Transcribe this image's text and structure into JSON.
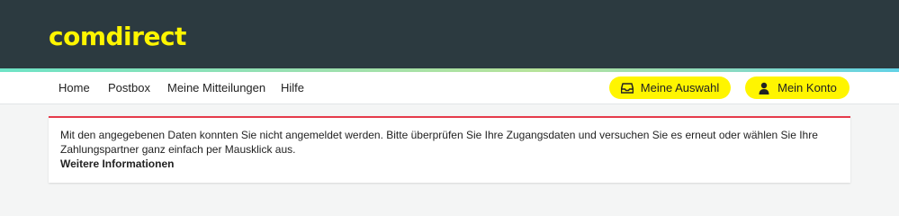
{
  "header": {
    "logo_text": "comdirect",
    "background_color": "#2c3a40",
    "logo_color": "#fff500"
  },
  "nav": {
    "items": [
      {
        "label": "Home"
      },
      {
        "label": "Postbox"
      },
      {
        "label": "Meine Mitteilungen"
      },
      {
        "label": "Hilfe"
      }
    ],
    "buttons": {
      "selection": {
        "label": "Meine Auswahl",
        "icon": "inbox-tray-icon"
      },
      "account": {
        "label": "Mein Konto",
        "icon": "user-icon"
      }
    },
    "button_color": "#fff500"
  },
  "alert": {
    "message": "Mit den angegebenen Daten konnten Sie nicht angemeldet werden. Bitte überprüfen Sie Ihre Zugangsdaten und versuchen Sie es erneut oder wählen Sie Ihre Zahlungspartner ganz einfach per Mausklick aus.",
    "link_label": "Weitere Informationen",
    "border_color": "#e53a4b"
  }
}
